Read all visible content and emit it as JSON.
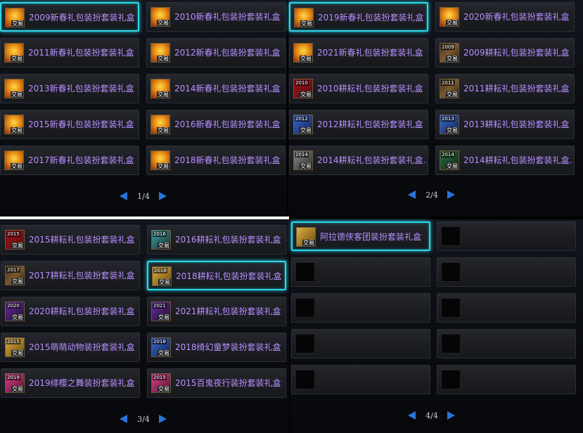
{
  "colors": {
    "accent": "#2fd6e6",
    "item_name": "#b990ff",
    "arrow": "#2a74d8"
  },
  "trade_tag": "交易",
  "panels": [
    {
      "page": "1/4",
      "items": [
        {
          "name": "2009新春礼包装扮套装礼盒",
          "icon": "newyear",
          "selected": true
        },
        {
          "name": "2010新春礼包装扮套装礼盒",
          "icon": "newyear"
        },
        {
          "name": "2011新春礼包装扮套装礼盒",
          "icon": "newyear"
        },
        {
          "name": "2012新春礼包装扮套装礼盒",
          "icon": "newyear"
        },
        {
          "name": "2013新春礼包装扮套装礼盒",
          "icon": "newyear"
        },
        {
          "name": "2014新春礼包装扮套装礼盒",
          "icon": "newyear"
        },
        {
          "name": "2015新春礼包装扮套装礼盒",
          "icon": "newyear"
        },
        {
          "name": "2016新春礼包装扮套装礼盒",
          "icon": "newyear"
        },
        {
          "name": "2017新春礼包装扮套装礼盒",
          "icon": "newyear"
        },
        {
          "name": "2018新春礼包装扮套装礼盒",
          "icon": "newyear"
        }
      ]
    },
    {
      "page": "2/4",
      "items": [
        {
          "name": "2019新春礼包装扮套装礼盒",
          "icon": "newyear",
          "selected": true
        },
        {
          "name": "2020新春礼包装扮套装礼盒",
          "icon": "newyear"
        },
        {
          "name": "2021新春礼包装扮套装礼盒",
          "icon": "newyear"
        },
        {
          "name": "2009耕耘礼包装扮套装礼盒",
          "icon": "plow",
          "year": "2009"
        },
        {
          "name": "2010耕耘礼包装扮套装礼盒",
          "icon": "red",
          "year": "2010"
        },
        {
          "name": "2011耕耘礼包装扮套装礼盒",
          "icon": "plow",
          "year": "2011"
        },
        {
          "name": "2012耕耘礼包装扮套装礼盒",
          "icon": "blue",
          "year": "2012"
        },
        {
          "name": "2013耕耘礼包装扮套装礼盒",
          "icon": "blue",
          "year": "2013"
        },
        {
          "name": "2014耕耘礼包装扮套装礼盒...",
          "icon": "gray",
          "year": "2014"
        },
        {
          "name": "2014耕耘礼包装扮套装礼盒...",
          "icon": "green",
          "year": "2014"
        }
      ]
    },
    {
      "page": "3/4",
      "items": [
        {
          "name": "2015耕耘礼包装扮套装礼盒",
          "icon": "red",
          "year": "2015"
        },
        {
          "name": "2016耕耘礼包装扮套装礼盒",
          "icon": "teal",
          "year": "2016"
        },
        {
          "name": "2017耕耘礼包装扮套装礼盒",
          "icon": "plow",
          "year": "2017"
        },
        {
          "name": "2018耕耘礼包装扮套装礼盒",
          "icon": "gold",
          "year": "2018",
          "selected": true
        },
        {
          "name": "2020耕耘礼包装扮套装礼盒",
          "icon": "purple",
          "year": "2020"
        },
        {
          "name": "2021耕耘礼包装扮套装礼盒",
          "icon": "purple",
          "year": "2021"
        },
        {
          "name": "2015萌萌动物装扮套装礼盒",
          "icon": "gold",
          "year": "2015"
        },
        {
          "name": "2018绮幻童梦装扮套装礼盒",
          "icon": "blue",
          "year": "2018"
        },
        {
          "name": "2019绯樱之舞装扮套装礼盒",
          "icon": "pink",
          "year": "2019"
        },
        {
          "name": "2015百鬼夜行装扮套装礼盒",
          "icon": "pink",
          "year": "2015"
        }
      ]
    },
    {
      "page": "4/4",
      "items": [
        {
          "name": "阿拉德侠客团装扮套装礼盒",
          "icon": "gold",
          "selected": true
        },
        {
          "empty": true
        },
        {
          "empty": true
        },
        {
          "empty": true
        },
        {
          "empty": true
        },
        {
          "empty": true
        },
        {
          "empty": true
        },
        {
          "empty": true
        },
        {
          "empty": true
        },
        {
          "empty": true
        }
      ]
    }
  ]
}
